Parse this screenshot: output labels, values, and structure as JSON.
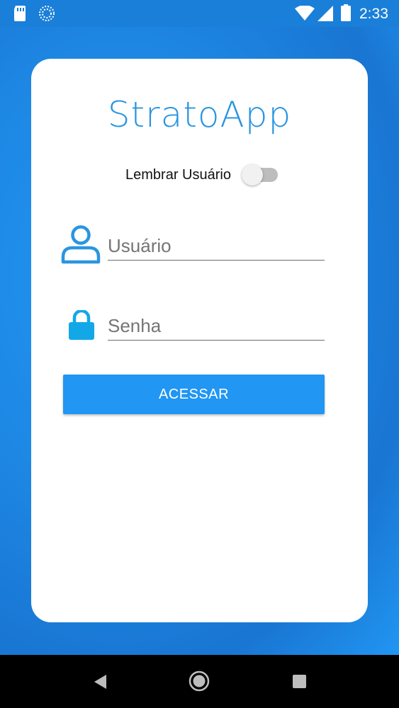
{
  "status_bar": {
    "time": "2:33",
    "icons": [
      "sd-card-icon",
      "sync-icon",
      "wifi-icon",
      "signal-icon",
      "battery-icon"
    ]
  },
  "app": {
    "title": "StratoApp",
    "accent_color": "#2196F3",
    "title_color": "#2A95E0"
  },
  "remember": {
    "label": "Lembrar Usuário",
    "enabled": false
  },
  "login_form": {
    "username_placeholder": "Usuário",
    "username_value": "",
    "password_placeholder": "Senha",
    "password_value": "",
    "submit_label": "ACESSAR"
  },
  "nav_bar": {
    "buttons": [
      "back-icon",
      "home-icon",
      "recent-apps-icon"
    ]
  }
}
